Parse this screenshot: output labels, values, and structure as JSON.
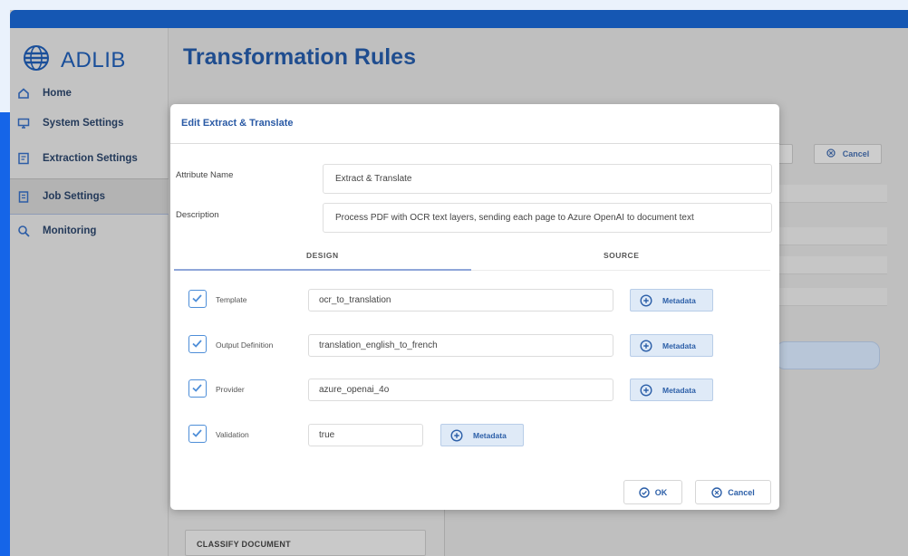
{
  "app": {
    "logo_text": "ADLIB"
  },
  "sidebar": {
    "items": [
      {
        "label": "Home",
        "icon": "home-icon"
      },
      {
        "label": "System Settings",
        "icon": "monitor-icon"
      },
      {
        "label": "Extraction Settings",
        "icon": "extract-icon"
      },
      {
        "label": "Job Settings",
        "icon": "clipboard-icon",
        "active": true
      },
      {
        "label": "Monitoring",
        "icon": "magnifier-icon"
      }
    ]
  },
  "page": {
    "title": "Transformation Rules",
    "background_cancel": "Cancel",
    "background_card": "CLASSIFY DOCUMENT"
  },
  "dialog": {
    "title": "Edit Extract & Translate",
    "attribute_name_label": "Attribute Name",
    "attribute_name_value": "Extract & Translate",
    "description_label": "Description",
    "description_value": "Process PDF with OCR text layers, sending each page to Azure OpenAI to document text",
    "tabs": [
      {
        "label": "DESIGN",
        "active": true
      },
      {
        "label": "SOURCE",
        "active": false
      }
    ],
    "params": [
      {
        "label": "Template",
        "value": "ocr_to_translation",
        "checked": true,
        "button": "Metadata"
      },
      {
        "label": "Output Definition",
        "value": "translation_english_to_french",
        "checked": true,
        "button": "Metadata"
      },
      {
        "label": "Provider",
        "value": "azure_openai_4o",
        "checked": true,
        "button": "Metadata"
      },
      {
        "label": "Validation",
        "value": "true",
        "checked": true,
        "button": "Metadata"
      }
    ],
    "ok_label": "OK",
    "cancel_label": "Cancel"
  },
  "colors": {
    "brand": "#1557b3",
    "accent": "#1565e8",
    "title": "#1f4d8f",
    "link": "#2c5fa8"
  }
}
